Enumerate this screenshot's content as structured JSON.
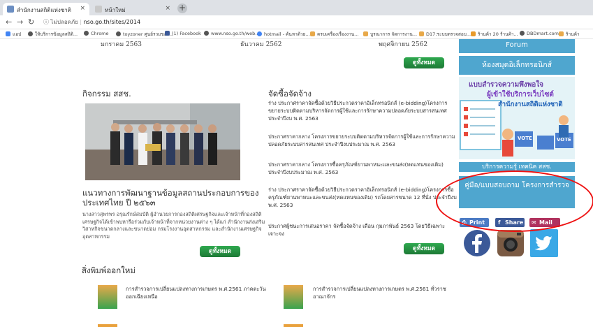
{
  "browser": {
    "tabs": [
      {
        "label": "สำนักงานสถิติแห่งชาติ",
        "active": true
      },
      {
        "label": "หน้าใหม่",
        "active": false
      }
    ],
    "new_tab": "+",
    "close_glyph": "×",
    "address": {
      "not_secure": "ไม่ปลอดภัย",
      "url": "nso.go.th/sites/2014"
    },
    "bookmarks": [
      "แอป",
      "ให้บริการข้อมูลสถิติ...",
      "Chrome",
      "toyzoner ศูนย์รวมของ...",
      "(1) Facebook",
      "www.nso.go.th/web...",
      "hotmail - ค้นหาด้วย...",
      "ครบเครื่องเรื่องงาน...",
      "บูรณาการ จัดการงาน...",
      "D17:ระบบตรวจสอบ...",
      "ร้านค้า 20 ร้านค้า...",
      "DBDmart.com",
      "ร้านค้า"
    ]
  },
  "dates": [
    "มกราคม 2563",
    "ธันวาคม 2562",
    "พฤศจิกายน 2562"
  ],
  "more_label": "ดูทั้งหมด",
  "activities": {
    "title": "กิจกรรม สสช.",
    "headline": "แนวทางการพัฒนาฐานข้อมูลสถานประกอบการของประเทศไทย ปี ๒๕๖๓",
    "description": "นางสาวสุพรพร อรุณรักษ์สมบัติ ผู้อำนวยการกองสถิติเศรษฐกิจและเจ้าหน้าที่กองสถิติเศรษฐกิจได้เข้าพบหารือร่วมกับเจ้าหน้าที่จากหน่วยงานต่าง ๆ ได้แก่ สำนักงานส่งเสริมวิสาหกิจขนาดกลางและขนาดย่อม กรมโรงงานอุตสาหกรรม และสำนักงานเศรษฐกิจอุตสาหกรรม"
  },
  "procurement": {
    "title": "จัดซื้อจัดจ้าง",
    "items": [
      "ร่าง ประกาศราคาจัดซื้อด้วยวิธีประกวดราคาอิเล็กทรอนิกส์ (e-bidding)โครงการขยายระบบติดตามบริหารจัดการผู้ใช้และการรักษาความปลอดภัยระบบสารสนเทศ ประจำปีงบ พ.ศ. 2563",
      "ประกาศราคากลาง โครงการขยายระบบติดตามบริหารจัดการผู้ใช้และการรักษาความปลอดภัยระบบสารสนเทศ ประจำปีงบประมาณ พ.ศ. 2563",
      "ประกาศราคากลาง โครงการซื้อครุภัณฑ์ยานพาหนะและขนส่ง(ทดแทนของเดิม) ประจำปีงบประมาณ พ.ศ. 2563",
      "ร่าง ประกาศราคาจัดซื้อด้วยวิธีประกวดราคาอิเล็กทรอนิกส์ (e-bidding)โครงการซื้อครุภัณฑ์ยานพาหนะและขนส่ง(ทดแทนของเดิม) รถโดยสารขนาด 12 ที่นั่ง ประจำปีงบ พ.ศ. 2563",
      "ประกาศผู้ชนะการเสนอราคา จัดซื้อจัดจ้าง เดือน กุมภาพันธ์ 2563 โดยวิธีเฉพาะเจาะจง"
    ]
  },
  "sidebar": {
    "forum": "Forum",
    "library": "ห้องสมุดอิเล็กทรอนิกส์",
    "banner_title": "แบบสำรวจความพึงพอใจ",
    "banner_sub1": "ผู้เข้าใช้บริการเว็บไซต์",
    "banner_sub2": "สำนักงานสถิติแห่งชาติ",
    "vote": "VOTE",
    "faded_btn": "บริการความรู้ เทคนิค สสช.",
    "manual_btn": "คู่มือ/แบบสอบถาม โครงการสำรวจ",
    "share": {
      "print": "Print",
      "share": "Share",
      "mail": "Mail"
    }
  },
  "colors": {
    "accent_blue": "#4fa6cf",
    "green_button": "#2fa84f",
    "highlight_circle": "#e11111"
  },
  "publications": {
    "title": "สิ่งพิมพ์ออกใหม่",
    "items": [
      "การสำรวจการเปลี่ยนแปลงทางการเกษตร พ.ศ.2561 ภาคตะวันออกเฉียงเหนือ",
      "การสำรวจการเปลี่ยนแปลงทางการเกษตร พ.ศ.2561 ทั่วราชอาณาจักร"
    ]
  }
}
